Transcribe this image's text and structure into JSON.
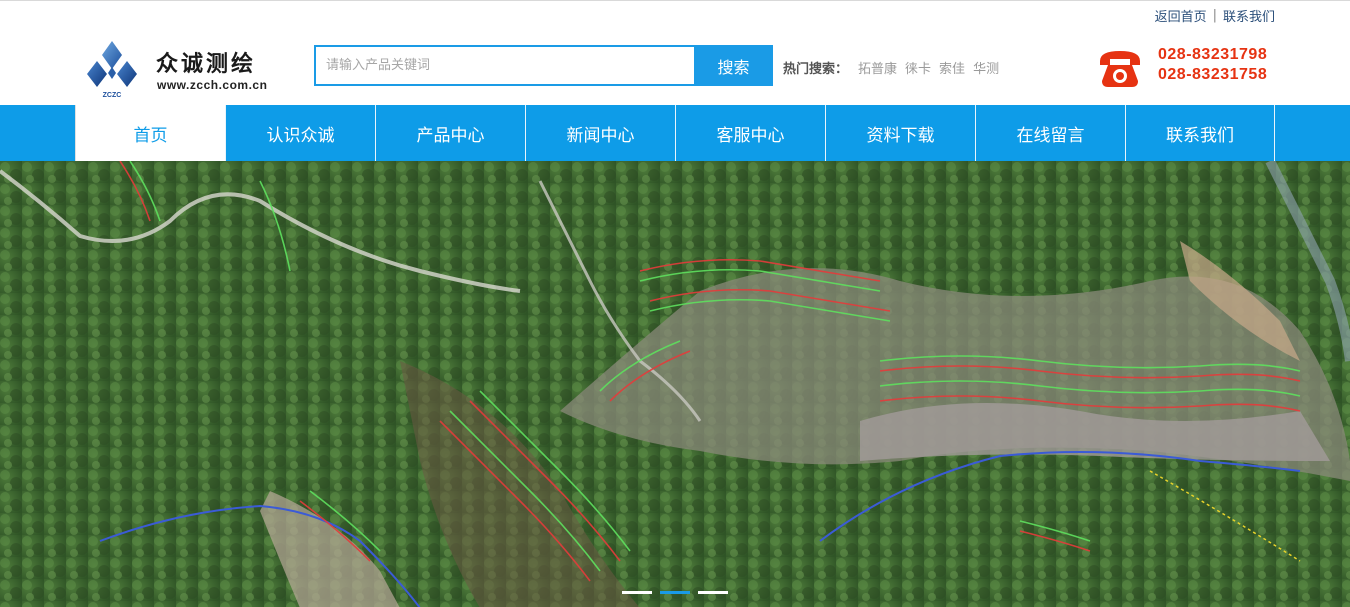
{
  "top_links": {
    "home_label": "返回首页",
    "separator": "|",
    "contact_label": "联系我们"
  },
  "logo": {
    "brand_name": "众诚测绘",
    "url_text": "www.zcch.com.cn",
    "mark_text": "ZCZC"
  },
  "search": {
    "placeholder": "请输入产品关键词",
    "button_label": "搜索"
  },
  "hot_search": {
    "label": "热门搜索：",
    "items": [
      "拓普康",
      "徕卡",
      "索佳",
      "华测"
    ]
  },
  "phone": {
    "numbers": [
      "028-83231798",
      "028-83231758"
    ],
    "icon": "telephone-icon"
  },
  "nav": {
    "items": [
      "首页",
      "认识众诚",
      "产品中心",
      "新闻中心",
      "客服中心",
      "资料下载",
      "在线留言",
      "联系我们"
    ],
    "active_index": 0
  },
  "banner": {
    "slides_count": 3,
    "active_slide": 1
  },
  "colors": {
    "accent": "#0e9ce8",
    "phone": "#e63312",
    "link": "#2b4f7a"
  }
}
